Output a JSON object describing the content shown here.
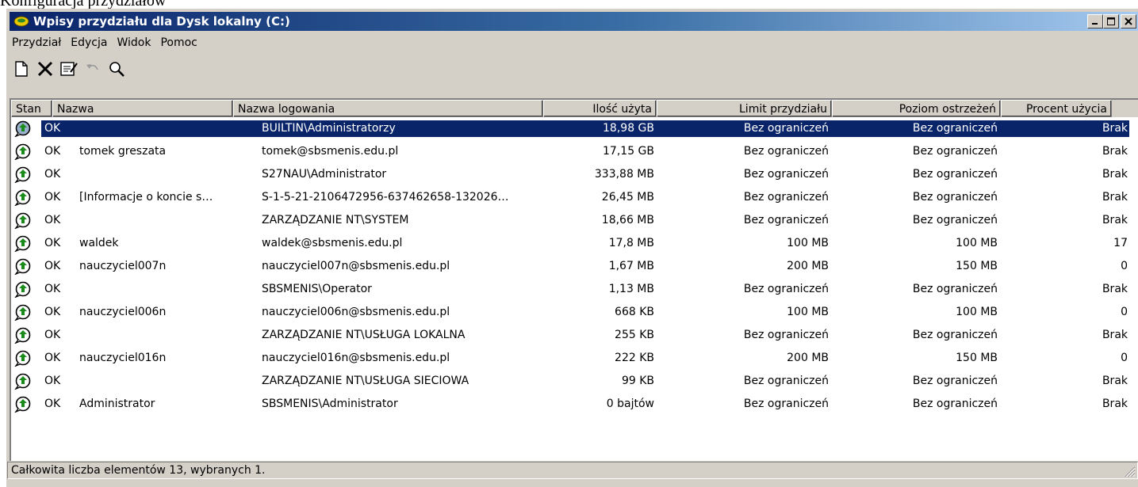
{
  "page_caption": "Konfiguracja przydziałów",
  "window": {
    "title": "Wpisy przydziału dla Dysk lokalny (C:)",
    "controls": {
      "minimize": "_",
      "maximize": "□",
      "close": "×"
    }
  },
  "menu": [
    "Przydział",
    "Edycja",
    "Widok",
    "Pomoc"
  ],
  "toolbar": [
    {
      "name": "new-quota-entry-icon",
      "label": "new-document-icon"
    },
    {
      "name": "delete-icon",
      "label": "delete-icon"
    },
    {
      "name": "properties-icon",
      "label": "properties-icon"
    },
    {
      "name": "undo-icon",
      "label": "undo-icon"
    },
    {
      "name": "find-icon",
      "label": "magnifier-icon"
    }
  ],
  "columns": [
    "Stan",
    "Nazwa",
    "Nazwa logowania",
    "Ilość użyta",
    "Limit przydziału",
    "Poziom ostrzeżeń",
    "Procent użycia"
  ],
  "rows": [
    {
      "status": "OK",
      "name": "",
      "login": "BUILTIN\\Administratorzy",
      "used": "18,98 GB",
      "limit": "Bez ograniczeń",
      "warning": "Bez ograniczeń",
      "percent": "Brak",
      "selected": true
    },
    {
      "status": "OK",
      "name": "tomek greszata",
      "login": "tomek@sbsmenis.edu.pl",
      "used": "17,15 GB",
      "limit": "Bez ograniczeń",
      "warning": "Bez ograniczeń",
      "percent": "Brak"
    },
    {
      "status": "OK",
      "name": "",
      "login": "S27NAU\\Administrator",
      "used": "333,88 MB",
      "limit": "Bez ograniczeń",
      "warning": "Bez ograniczeń",
      "percent": "Brak"
    },
    {
      "status": "OK",
      "name": "[Informacje o koncie s…",
      "login": "S-1-5-21-2106472956-637462658-132026…",
      "used": "26,45 MB",
      "limit": "Bez ograniczeń",
      "warning": "Bez ograniczeń",
      "percent": "Brak"
    },
    {
      "status": "OK",
      "name": "",
      "login": "ZARZĄDZANIE NT\\SYSTEM",
      "used": "18,66 MB",
      "limit": "Bez ograniczeń",
      "warning": "Bez ograniczeń",
      "percent": "Brak"
    },
    {
      "status": "OK",
      "name": "waldek",
      "login": "waldek@sbsmenis.edu.pl",
      "used": "17,8 MB",
      "limit": "100 MB",
      "warning": "100 MB",
      "percent": "17"
    },
    {
      "status": "OK",
      "name": "nauczyciel007n",
      "login": "nauczyciel007n@sbsmenis.edu.pl",
      "used": "1,67 MB",
      "limit": "200 MB",
      "warning": "150 MB",
      "percent": "0"
    },
    {
      "status": "OK",
      "name": "",
      "login": "SBSMENIS\\Operator",
      "used": "1,13 MB",
      "limit": "Bez ograniczeń",
      "warning": "Bez ograniczeń",
      "percent": "Brak"
    },
    {
      "status": "OK",
      "name": "nauczyciel006n",
      "login": "nauczyciel006n@sbsmenis.edu.pl",
      "used": "668 KB",
      "limit": "100 MB",
      "warning": "100 MB",
      "percent": "0"
    },
    {
      "status": "OK",
      "name": "",
      "login": "ZARZĄDZANIE NT\\USŁUGA LOKALNA",
      "used": "255 KB",
      "limit": "Bez ograniczeń",
      "warning": "Bez ograniczeń",
      "percent": "Brak"
    },
    {
      "status": "OK",
      "name": "nauczyciel016n",
      "login": "nauczyciel016n@sbsmenis.edu.pl",
      "used": "222 KB",
      "limit": "200 MB",
      "warning": "150 MB",
      "percent": "0"
    },
    {
      "status": "OK",
      "name": "",
      "login": "ZARZĄDZANIE NT\\USŁUGA SIECIOWA",
      "used": "99 KB",
      "limit": "Bez ograniczeń",
      "warning": "Bez ograniczeń",
      "percent": "Brak"
    },
    {
      "status": "OK",
      "name": "Administrator",
      "login": "SBSMENIS\\Administrator",
      "used": "0 bajtów",
      "limit": "Bez ograniczeń",
      "warning": "Bez ograniczeń",
      "percent": "Brak"
    }
  ],
  "status_bar": "Całkowita liczba elementów 13, wybranych 1.",
  "colors": {
    "selection": "#0a246a",
    "titlebar_start": "#0a246a",
    "titlebar_end": "#a6caf0",
    "chrome": "#d4d0c8",
    "ok_icon": "#1a8a1a"
  }
}
